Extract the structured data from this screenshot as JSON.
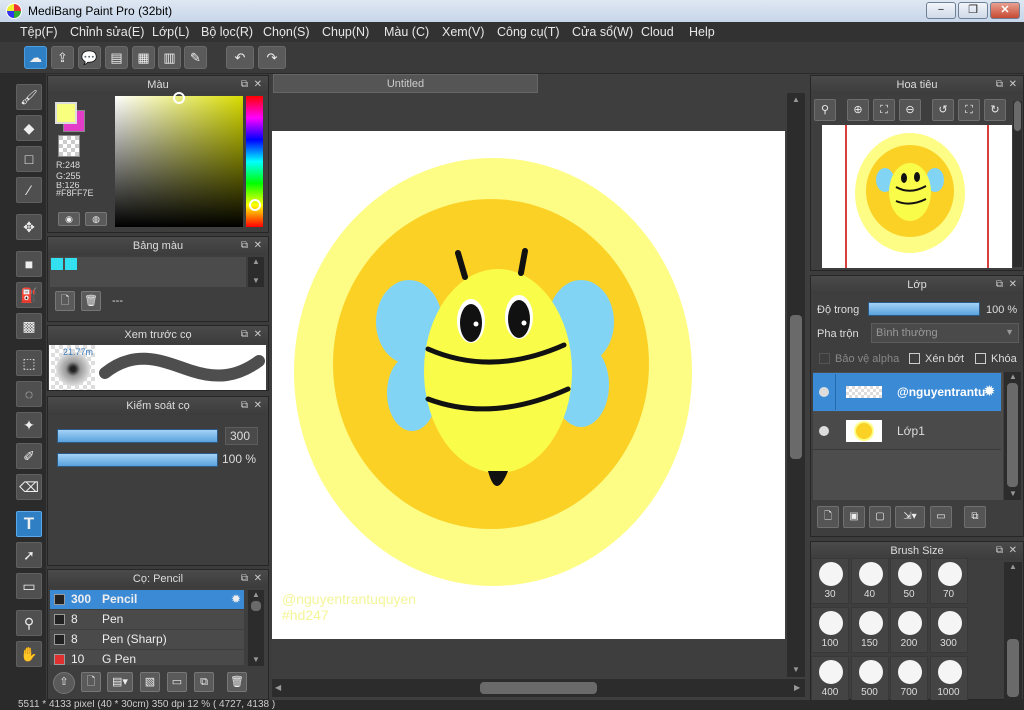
{
  "window": {
    "title": "MediBang Paint Pro (32bit)",
    "min": "−",
    "max": "❐",
    "close": "✕"
  },
  "menu": [
    "Tệp(F)",
    "Chỉnh sửa(E)",
    "Lớp(L)",
    "Bộ lọc(R)",
    "Chọn(S)",
    "Chụp(N)",
    "Màu (C)",
    "Xem(V)",
    "Công cụ(T)",
    "Cửa sổ(W)",
    "Cloud",
    "Help"
  ],
  "toolbar": {
    "icons": [
      "cloud-icon",
      "share-icon",
      "speech-bubble-icon",
      "comment-icon",
      "page-icon",
      "panel-icon",
      "edit-icon",
      "undo-icon",
      "redo-icon"
    ]
  },
  "tools": {
    "text_tool": "T"
  },
  "color_panel": {
    "title": "Màu",
    "r": "R:248",
    "g": "G:255",
    "b": "B:126",
    "hex": "#F8FF7E",
    "fg_color": "#F8FF7E",
    "bg_color": "#E23CC8"
  },
  "palette_panel": {
    "title": "Bảng màu",
    "swatch_1": "#33E0F0",
    "swatch_2": "#33E0F0",
    "name": "---"
  },
  "preview_panel": {
    "title": "Xem trước cọ",
    "size_label": "21.77m"
  },
  "brush_control": {
    "title": "Kiểm soát cọ",
    "size": "300",
    "opacity": "100 %"
  },
  "brush_panel": {
    "title": "Cọ: Pencil",
    "items": [
      {
        "size": "300",
        "name": "Pencil",
        "color": "#222222"
      },
      {
        "size": "8",
        "name": "Pen",
        "color": "#222222"
      },
      {
        "size": "8",
        "name": "Pen (Sharp)",
        "color": "#222222"
      },
      {
        "size": "10",
        "name": "G Pen",
        "color": "#E03030"
      }
    ]
  },
  "canvas": {
    "tab": "Untitled",
    "watermark_line1": "@nguyentrantuquyen",
    "watermark_line2": "#hd247"
  },
  "navigator": {
    "title": "Hoa tiêu"
  },
  "layer_panel": {
    "title": "Lớp",
    "opacity_label": "Độ trong",
    "opacity_value": "100 %",
    "blend_label": "Pha trộn",
    "blend_value": "Bình thường",
    "protect_alpha": "Bảo vệ alpha",
    "clipping": "Xén bớt",
    "lock": "Khóa",
    "layers": [
      {
        "name": "@nguyentrantu"
      },
      {
        "name": "Lớp1"
      }
    ]
  },
  "brush_size_panel": {
    "title": "Brush Size",
    "sizes": [
      "30",
      "40",
      "50",
      "70",
      "100",
      "150",
      "200",
      "300",
      "400",
      "500",
      "700",
      "1000"
    ]
  },
  "status": {
    "text": "5511 * 4133 pixel   (40 * 30cm)   350 dpi   12 %   ( 4727, 4138 )"
  }
}
